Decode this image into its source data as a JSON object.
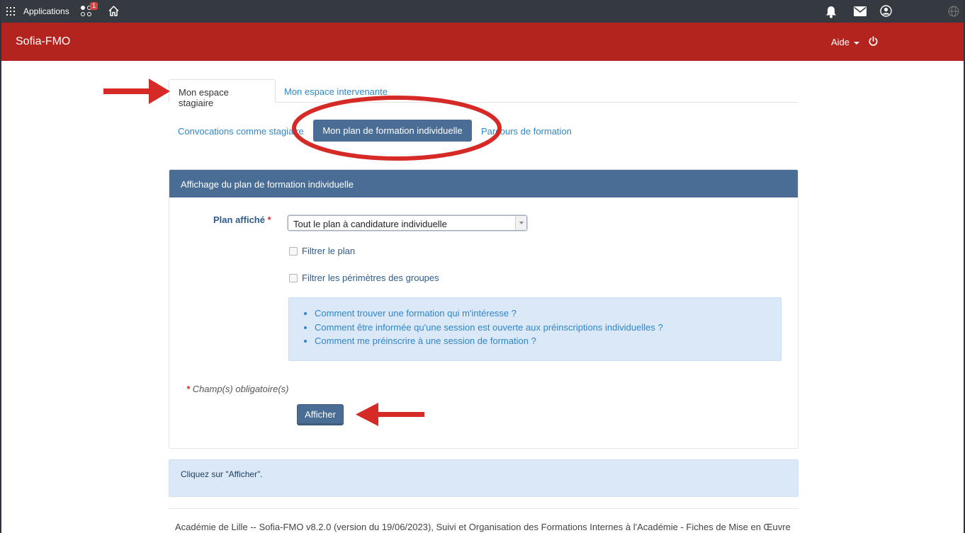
{
  "topbar": {
    "apps_label": "Applications",
    "notification_count": "1"
  },
  "header": {
    "brand": "Sofia-FMO",
    "help_label": "Aide"
  },
  "tabs": [
    {
      "label": "Mon espace stagiaire",
      "active": true
    },
    {
      "label": "Mon espace intervenante",
      "active": false
    }
  ],
  "pills": [
    {
      "label": "Convocations comme stagiaire",
      "active": false
    },
    {
      "label": "Mon plan de formation individuelle",
      "active": true
    },
    {
      "label": "Parcours de formation",
      "active": false
    }
  ],
  "panel": {
    "title": "Affichage du plan de formation individuelle",
    "plan_label": "Plan affiché",
    "required_mark": "*",
    "plan_selected": "Tout le plan à candidature individuelle",
    "filter_plan": "Filtrer le plan",
    "filter_groups": "Filtrer les périmètres des groupes",
    "help_links": [
      "Comment trouver une formation qui m'intéresse ?",
      "Comment être informée qu'une session est ouverte aux préinscriptions individuelles ?",
      "Comment me préinscrire à une session de formation ?"
    ],
    "mandatory_note": "Champ(s) obligatoire(s)",
    "submit_label": "Afficher"
  },
  "alert": "Cliquez sur \"Afficher\".",
  "footer": "Académie de Lille -- Sofia-FMO v8.2.0 (version du 19/06/2023), Suivi et Organisation des Formations Internes à l'Académie - Fiches de Mise en Œuvre",
  "colors": {
    "topbar": "#343a40",
    "header": "#b4241f",
    "accent": "#4a6d95",
    "link": "#2f86c8",
    "annotation": "#d52a26"
  }
}
